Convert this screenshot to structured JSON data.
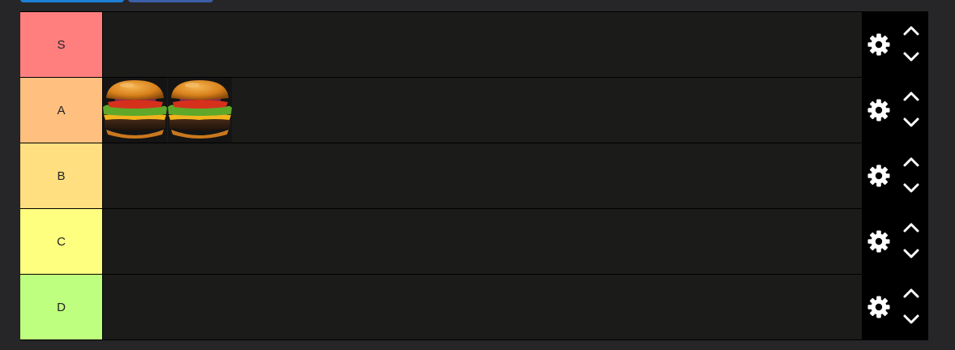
{
  "tiers": [
    {
      "label": "S",
      "color": "#ff7f7f",
      "items": []
    },
    {
      "label": "A",
      "color": "#ffbf7f",
      "items": [
        "burger",
        "burger"
      ]
    },
    {
      "label": "B",
      "color": "#ffdf7f",
      "items": []
    },
    {
      "label": "C",
      "color": "#ffff7f",
      "items": []
    },
    {
      "label": "D",
      "color": "#bfff7f",
      "items": []
    }
  ],
  "icons": {
    "settings": "gear-icon",
    "move_up": "chevron-up-icon",
    "move_down": "chevron-down-icon",
    "item_image": "burger-image"
  },
  "colors": {
    "page_background": "#262527",
    "row_background": "#1b1c1a",
    "controls_background": "#000000",
    "top_button_primary": "#1b7fd6",
    "top_button_secondary": "#3b5fa8"
  }
}
